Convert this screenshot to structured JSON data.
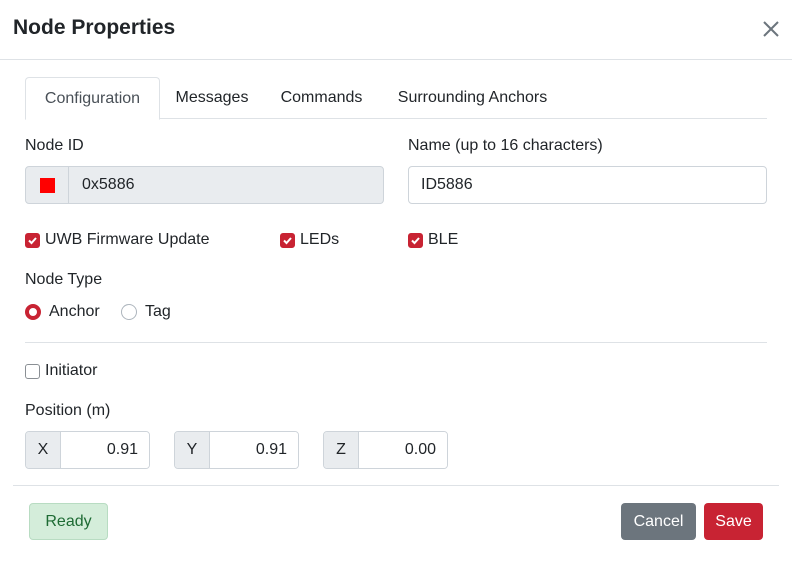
{
  "dialog": {
    "title": "Node Properties",
    "close_icon": "close-icon"
  },
  "tabs": [
    {
      "label": "Configuration",
      "active": true
    },
    {
      "label": "Messages",
      "active": false
    },
    {
      "label": "Commands",
      "active": false
    },
    {
      "label": "Surrounding Anchors",
      "active": false
    }
  ],
  "node_id": {
    "label": "Node ID",
    "value": "0x5886",
    "color": "#ff0000"
  },
  "name": {
    "label": "Name (up to 16 characters)",
    "value": "ID5886"
  },
  "options": [
    {
      "label": "UWB Firmware Update",
      "checked": true
    },
    {
      "label": "LEDs",
      "checked": true
    },
    {
      "label": "BLE",
      "checked": true
    }
  ],
  "node_type": {
    "label": "Node Type",
    "options": [
      {
        "label": "Anchor",
        "selected": true
      },
      {
        "label": "Tag",
        "selected": false
      }
    ]
  },
  "initiator": {
    "label": "Initiator",
    "checked": false
  },
  "position": {
    "label": "Position (m)",
    "x": {
      "prefix": "X",
      "value": "0.91"
    },
    "y": {
      "prefix": "Y",
      "value": "0.91"
    },
    "z": {
      "prefix": "Z",
      "value": "0.00"
    }
  },
  "footer": {
    "status": "Ready",
    "cancel_label": "Cancel",
    "save_label": "Save"
  },
  "colors": {
    "accent": "#c82333",
    "status_bg": "#d4edda",
    "cancel_bg": "#6c757d"
  }
}
